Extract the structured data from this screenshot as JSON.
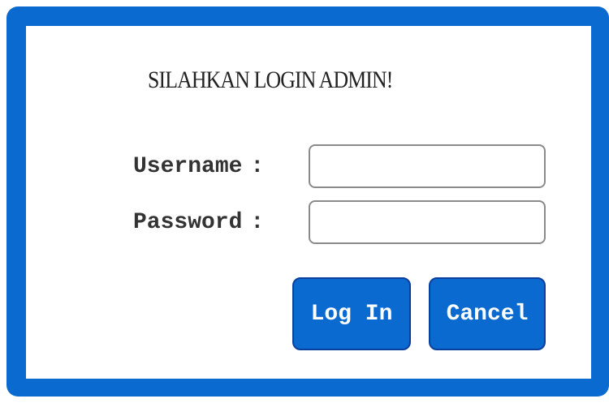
{
  "form": {
    "title": "SILAHKAN LOGIN ADMIN!",
    "username_label": "Username",
    "password_label": "Password",
    "separator": ":",
    "username_value": "",
    "password_value": "",
    "login_label": "Log In",
    "cancel_label": "Cancel"
  },
  "colors": {
    "frame": "#0b6ad0",
    "button": "#0b6ad0",
    "button_border": "#0a3f9e",
    "panel": "#ffffff"
  }
}
